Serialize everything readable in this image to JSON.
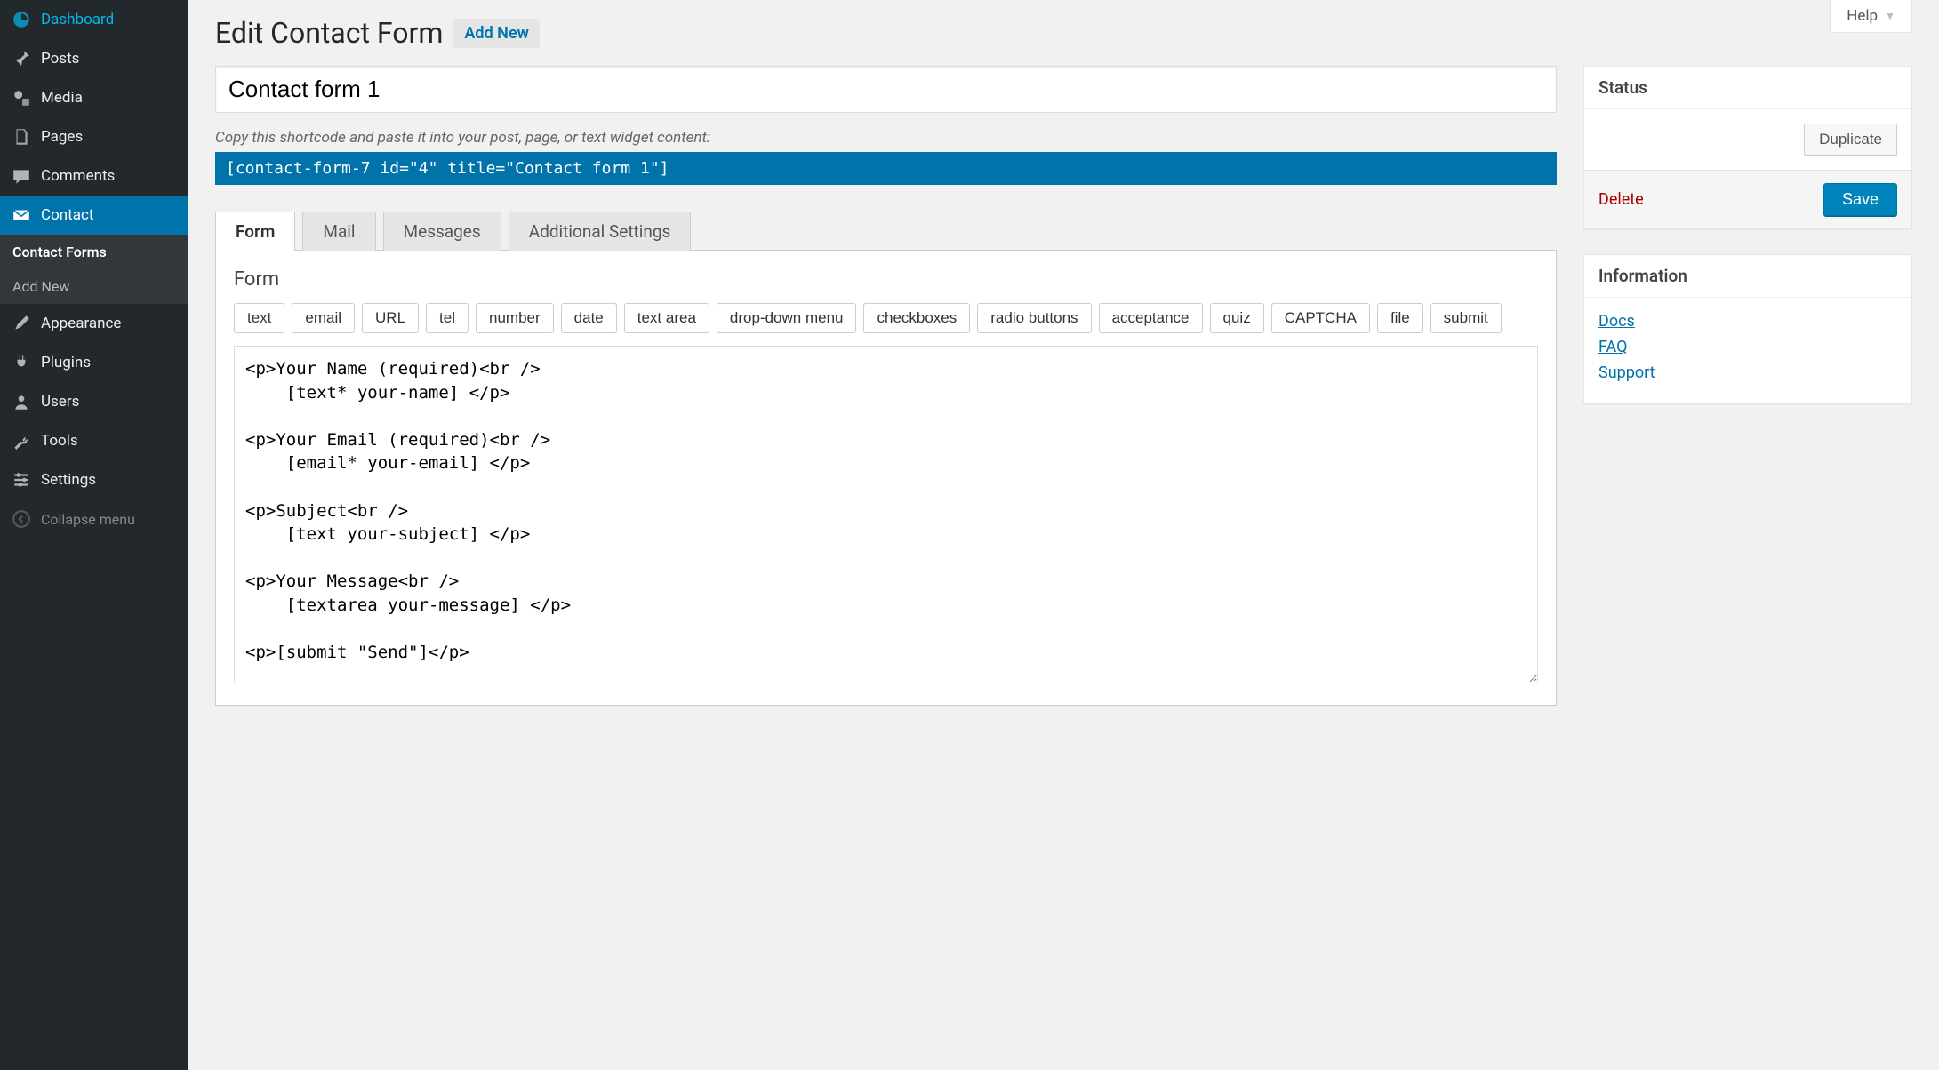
{
  "help": {
    "label": "Help"
  },
  "sidebar": {
    "items": [
      {
        "label": "Dashboard"
      },
      {
        "label": "Posts"
      },
      {
        "label": "Media"
      },
      {
        "label": "Pages"
      },
      {
        "label": "Comments"
      },
      {
        "label": "Contact"
      },
      {
        "label": "Appearance"
      },
      {
        "label": "Plugins"
      },
      {
        "label": "Users"
      },
      {
        "label": "Tools"
      },
      {
        "label": "Settings"
      }
    ],
    "submenu": [
      {
        "label": "Contact Forms"
      },
      {
        "label": "Add New"
      }
    ],
    "collapse": "Collapse menu"
  },
  "header": {
    "title": "Edit Contact Form",
    "add_new": "Add New"
  },
  "form": {
    "title_value": "Contact form 1",
    "shortcode_hint": "Copy this shortcode and paste it into your post, page, or text widget content:",
    "shortcode": "[contact-form-7 id=\"4\" title=\"Contact form 1\"]"
  },
  "tabs": [
    {
      "label": "Form"
    },
    {
      "label": "Mail"
    },
    {
      "label": "Messages"
    },
    {
      "label": "Additional Settings"
    }
  ],
  "panel": {
    "heading": "Form",
    "tag_buttons": [
      "text",
      "email",
      "URL",
      "tel",
      "number",
      "date",
      "text area",
      "drop-down menu",
      "checkboxes",
      "radio buttons",
      "acceptance",
      "quiz",
      "CAPTCHA",
      "file",
      "submit"
    ],
    "textarea": "<p>Your Name (required)<br />\n    [text* your-name] </p>\n\n<p>Your Email (required)<br />\n    [email* your-email] </p>\n\n<p>Subject<br />\n    [text your-subject] </p>\n\n<p>Your Message<br />\n    [textarea your-message] </p>\n\n<p>[submit \"Send\"]</p>"
  },
  "status": {
    "heading": "Status",
    "duplicate": "Duplicate",
    "delete": "Delete",
    "save": "Save"
  },
  "info": {
    "heading": "Information",
    "links": [
      "Docs",
      "FAQ",
      "Support"
    ]
  }
}
